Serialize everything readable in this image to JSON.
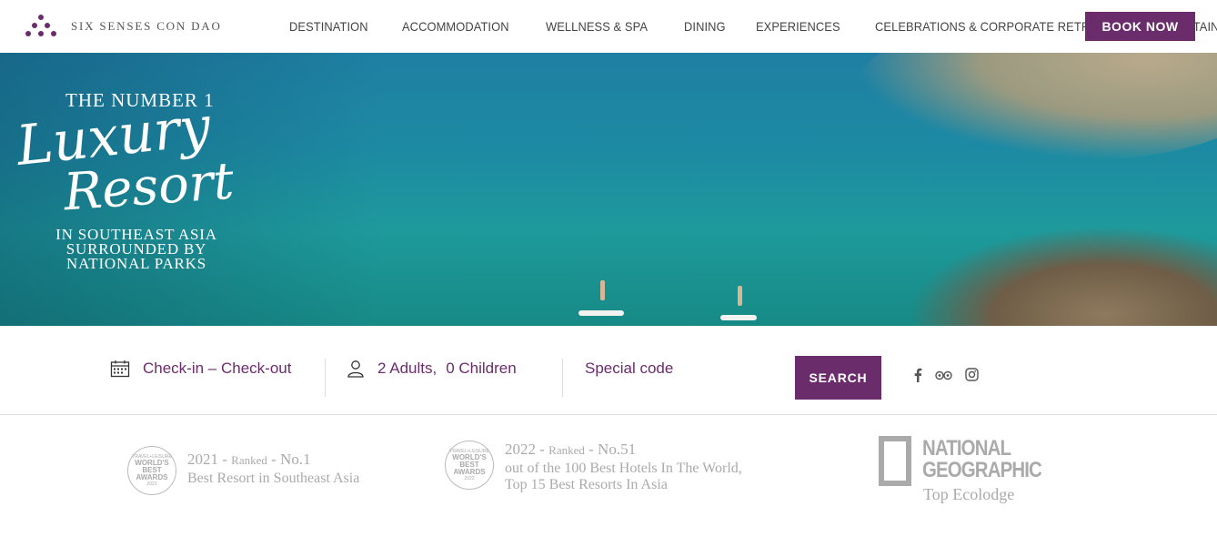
{
  "brand": {
    "name": "SIX SENSES CON DAO",
    "color": "#6b2c6c"
  },
  "nav": {
    "items": [
      {
        "label": "DESTINATION"
      },
      {
        "label": "ACCOMMODATION"
      },
      {
        "label": "WELLNESS & SPA"
      },
      {
        "label": "DINING"
      },
      {
        "label": "EXPERIENCES"
      },
      {
        "label": "CELEBRATIONS & CORPORATE RETREATS"
      },
      {
        "label": "SUSTAINABILITY"
      }
    ],
    "book_now": "BOOK NOW"
  },
  "hero": {
    "line1": "THE NUMBER 1",
    "line2": "Luxury",
    "line3": "Resort",
    "line4": "IN SOUTHEAST ASIA",
    "line5": "SURROUNDED BY",
    "line6": "NATIONAL PARKS"
  },
  "booking": {
    "dates": "Check-in – Check-out",
    "adults": "2 Adults,",
    "children": "0 Children",
    "special_code": "Special code",
    "search": "SEARCH",
    "icons": [
      "calendar-icon",
      "user-icon",
      "facebook-icon",
      "tripadvisor-icon",
      "instagram-icon"
    ]
  },
  "awards": [
    {
      "badge_top": "TRAVEL+LEISURE",
      "badge_mid": "WORLD'S BEST AWARDS",
      "badge_year": "2022",
      "year": "2021 -",
      "ranked": "Ranked",
      "rank": "- No.1",
      "desc": "Best Resort in Southeast Asia"
    },
    {
      "badge_top": "TRAVEL+LEISURE",
      "badge_mid": "WORLD'S BEST AWARDS",
      "badge_year": "2022",
      "year": "2022 -",
      "ranked": "Ranked",
      "rank": "- No.51",
      "desc": "out of the 100 Best Hotels In The World,",
      "desc2": "Top 15 Best Resorts In Asia"
    }
  ],
  "natgeo": {
    "line1": "NATIONAL",
    "line2": "GEOGRAPHIC",
    "sub": "Top Ecolodge"
  }
}
